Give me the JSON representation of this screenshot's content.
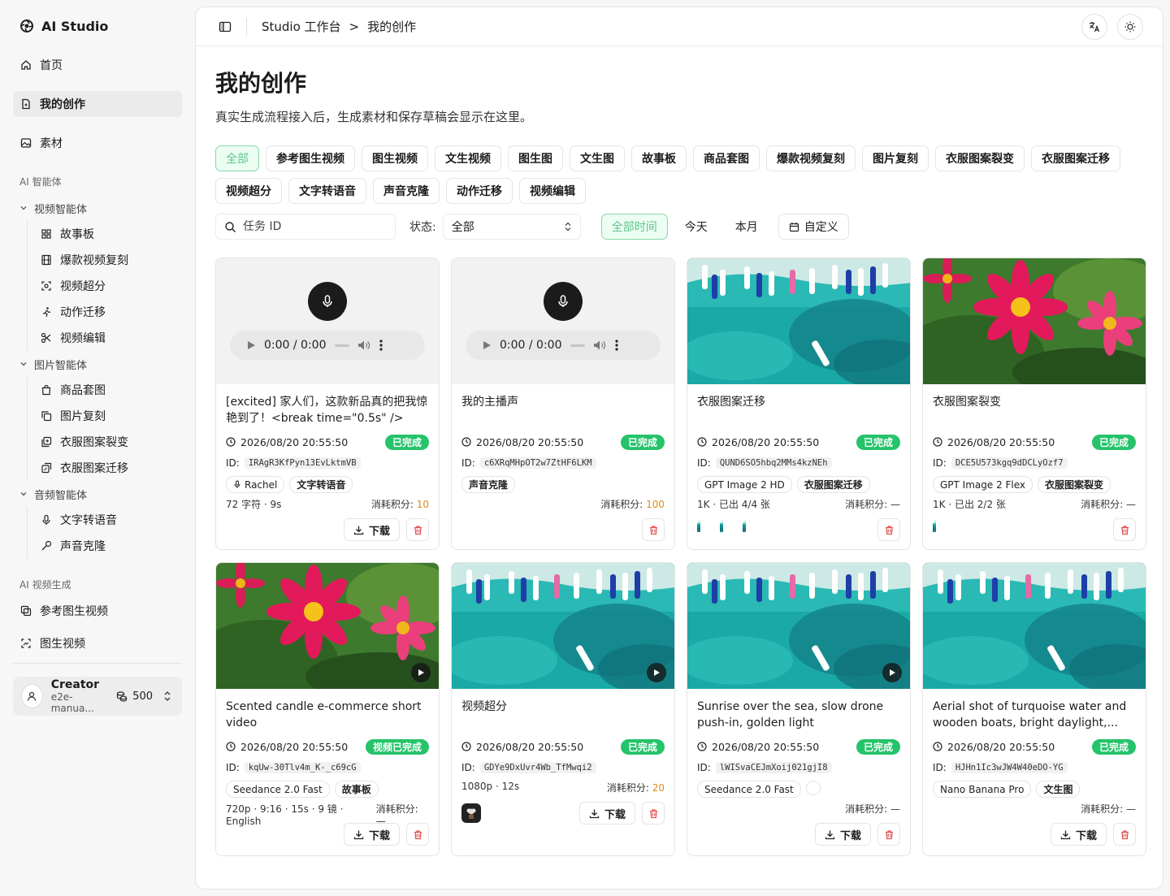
{
  "brand": {
    "name": "AI Studio"
  },
  "sidebar": {
    "home": "首页",
    "my_creations": "我的创作",
    "materials": "素材",
    "section_ai": "AI 智能体",
    "video_group": "视频智能体",
    "video_items": [
      "故事板",
      "爆款视频复刻",
      "视频超分",
      "动作迁移",
      "视频编辑"
    ],
    "image_group": "图片智能体",
    "image_items": [
      "商品套图",
      "图片复刻",
      "衣服图案裂变",
      "衣服图案迁移"
    ],
    "audio_group": "音频智能体",
    "audio_items": [
      "文字转语音",
      "声音克隆"
    ],
    "section_gen": "AI 视频生成",
    "gen_items": [
      "参考图生视频",
      "图生视频"
    ]
  },
  "user": {
    "name": "Creator",
    "email": "e2e-manua...",
    "credits": "500"
  },
  "breadcrumb": {
    "root": "Studio 工作台",
    "sep": ">",
    "current": "我的创作"
  },
  "page": {
    "title": "我的创作",
    "description": "真实生成流程接入后，生成素材和保存草稿会显示在这里。"
  },
  "tabs": [
    "全部",
    "参考图生视频",
    "图生视频",
    "文生视频",
    "图生图",
    "文生图",
    "故事板",
    "商品套图",
    "爆款视频复刻",
    "图片复刻",
    "衣服图案裂变",
    "衣服图案迁移",
    "视频超分",
    "文字转语音",
    "声音克隆",
    "动作迁移",
    "视频编辑"
  ],
  "filters": {
    "search_placeholder": "任务 ID",
    "status_label": "状态:",
    "status_value": "全部",
    "time_tabs": [
      "全部时间",
      "今天",
      "本月"
    ],
    "custom": "自定义"
  },
  "labels": {
    "download": "下载",
    "id_prefix": "ID:"
  },
  "cards": [
    {
      "title": "[excited] 家人们，这款新品真的把我惊艳到了！<break time=\"0.5s\" /> 面...",
      "time": "2026/08/20 20:55:50",
      "status": "已完成",
      "id": "IRAgR3KfPyn13EvLktmVB",
      "audio_time": "0:00 / 0:00",
      "chips": [
        "Rachel",
        "文字转语音"
      ],
      "meta_left": "72 字符 · 9s",
      "cost_label": "消耗积分:",
      "cost": "10"
    },
    {
      "title": "我的主播声",
      "time": "2026/08/20 20:55:50",
      "status": "已完成",
      "id": "c6XRqMHpOT2w7ZtHF6LKM",
      "audio_time": "0:00 / 0:00",
      "chips": [
        "声音克隆"
      ],
      "meta_left": "",
      "cost_label": "消耗积分:",
      "cost": "100"
    },
    {
      "title": "衣服图案迁移",
      "time": "2026/08/20 20:55:50",
      "status": "已完成",
      "id": "QUND6SO5hbq2MMs4kzNEh",
      "chips": [
        "GPT Image 2 HD",
        "衣服图案迁移"
      ],
      "meta_left": "1K · 已出 4/4 张",
      "cost_label": "消耗积分:",
      "cost": "—"
    },
    {
      "title": "衣服图案裂变",
      "time": "2026/08/20 20:55:50",
      "status": "已完成",
      "id": "DCE5U573kgq9dDCLyOzf7",
      "chips": [
        "GPT Image 2 Flex",
        "衣服图案裂变"
      ],
      "meta_left": "1K · 已出 2/2 张",
      "cost_label": "消耗积分:",
      "cost": "—"
    },
    {
      "title": "Scented candle e-commerce short video",
      "time": "2026/08/20 20:55:50",
      "status": "视频已完成",
      "id": "kqUw-30Tlv4m_K-_c69cG",
      "chips": [
        "Seedance 2.0 Fast",
        "故事板"
      ],
      "meta_left": "720p · 9:16 · 15s · 9 镜 · English",
      "cost_label": "消耗积分:",
      "cost": "—"
    },
    {
      "title": "视频超分",
      "time": "2026/08/20 20:55:50",
      "status": "已完成",
      "id": "GDYe9DxUvr4Wb_TfMwqi2",
      "chips": [],
      "meta_left": "1080p · 12s",
      "cost_label": "消耗积分:",
      "cost": "20"
    },
    {
      "title": "Sunrise over the sea, slow drone push-in, golden light",
      "time": "2026/08/20 20:55:50",
      "status": "已完成",
      "id": "lWISvaCEJmXoij021gjI8",
      "chips": [
        "Seedance 2.0 Fast"
      ],
      "meta_left": "",
      "cost_label": "消耗积分:",
      "cost": "—"
    },
    {
      "title": "Aerial shot of turquoise water and wooden boats, bright daylight,...",
      "time": "2026/08/20 20:55:50",
      "status": "已完成",
      "id": "HJHn1Ic3wJW4W40eDO-YG",
      "chips": [
        "Nano Banana Pro",
        "文生图"
      ],
      "meta_left": "",
      "cost_label": "消耗积分:",
      "cost": "—"
    }
  ],
  "colors": {
    "accent_green": "#25c36a",
    "active_tab_bg": "#ecfdf3",
    "cost_orange": "#e08a1e",
    "delete_red": "#e05050"
  }
}
